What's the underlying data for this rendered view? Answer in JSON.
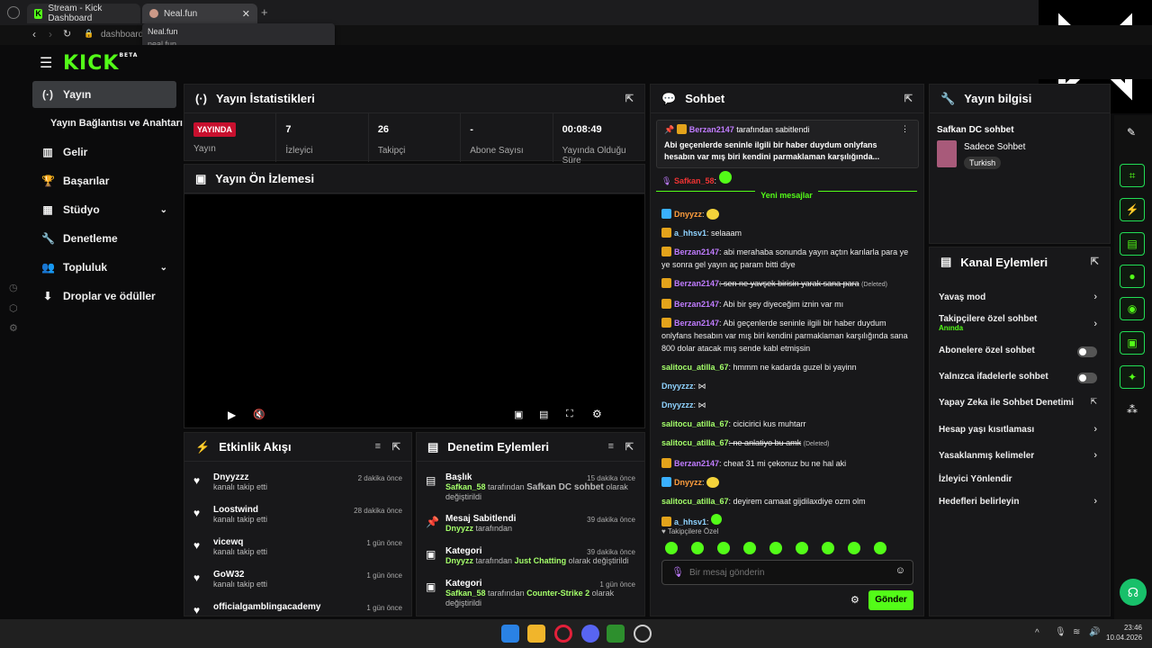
{
  "browser": {
    "tabs": [
      {
        "label": "Stream - Kick Dashboard"
      },
      {
        "label": "Neal.fun"
      }
    ],
    "address": "dashboard.",
    "tooltip": {
      "title": "Neal.fun",
      "url": "neal.fun"
    }
  },
  "app": {
    "logo": "KICK",
    "logo_sup": "BETA"
  },
  "sidebar": {
    "items": [
      {
        "label": "Yayın"
      },
      {
        "label": "Yayın Bağlantısı ve Anahtarı"
      },
      {
        "label": "Gelir"
      },
      {
        "label": "Başarılar"
      },
      {
        "label": "Stüdyo"
      },
      {
        "label": "Denetleme"
      },
      {
        "label": "Topluluk"
      },
      {
        "label": "Droplar ve ödüller"
      }
    ]
  },
  "stats_panel": {
    "title": "Yayın İstatistikleri",
    "live_badge": "YAYINDA",
    "stream_label": "Yayın",
    "viewers": {
      "value": "7",
      "label": "İzleyici"
    },
    "followers": {
      "value": "26",
      "label": "Takipçi"
    },
    "subs": {
      "value": "-",
      "label": "Abone Sayısı"
    },
    "uptime": {
      "value": "00:08:49",
      "label": "Yayında Olduğu Süre"
    }
  },
  "preview_panel": {
    "title": "Yayın Ön İzlemesi"
  },
  "activity_panel": {
    "title": "Etkinlik Akışı",
    "items": [
      {
        "name": "Dnyyzzz",
        "sub": "kanalı takip etti",
        "time": "2 dakika önce"
      },
      {
        "name": "Loostwind",
        "sub": "kanalı takip etti",
        "time": "28 dakika önce"
      },
      {
        "name": "vicewq",
        "sub": "kanalı takip etti",
        "time": "1 gün önce"
      },
      {
        "name": "GoW32",
        "sub": "kanalı takip etti",
        "time": "1 gün önce"
      },
      {
        "name": "officialgamblingacademy",
        "sub": "",
        "time": "1 gün önce"
      }
    ]
  },
  "mod_panel": {
    "title": "Denetim Eylemleri",
    "items": [
      {
        "title": "Başlık",
        "user": "Safkan_58",
        "mid": "tarafından",
        "target": "Safkan DC sohbet",
        "end": "olarak değiştirildi",
        "time": "15 dakika önce"
      },
      {
        "title": "Mesaj Sabitlendi",
        "user": "Dnyyzz",
        "mid": "tarafından",
        "target": "",
        "end": "",
        "time": "39 dakika önce"
      },
      {
        "title": "Kategori",
        "user": "Dnyyzz",
        "mid": "tarafından",
        "target": "Just Chatting",
        "end": "olarak değiştirildi",
        "time": "39 dakika önce"
      },
      {
        "title": "Kategori",
        "user": "Safkan_58",
        "mid": "tarafından",
        "target": "Counter-Strike 2",
        "end": "olarak değiştirildi",
        "time": "1 gün önce"
      }
    ]
  },
  "chat": {
    "title": "Sohbet",
    "pinned_by": "Berzan2147",
    "pinned_suffix": "tarafından sabitlendi",
    "pinned_text": "Abi geçenlerde seninle ilgili bir haber duydum onlyfans hesabın var mış biri kendini parmaklaman karşılığında...",
    "top_user": "Safkan_58",
    "new_messages": "Yeni mesajlar",
    "messages": [
      {
        "user": "Dnyyzz",
        "text": "",
        "cls": "orange"
      },
      {
        "user": "a_hhsv1",
        "text": ": selaaam",
        "cls": "lblue"
      },
      {
        "user": "Berzan2147",
        "text": ": abi merahaba sonunda yayın açtın karılarla para ye ye sonra gel yayın aç param bitti diye",
        "cls": "purple"
      },
      {
        "user": "Berzan2147",
        "text": ": sen ne yavşek birisin yarak sana para",
        "cls": "purple",
        "deleted": "(Deleted)"
      },
      {
        "user": "Berzan2147",
        "text": ": Abi bir şey diyeceğim iznin var mı",
        "cls": "purple"
      },
      {
        "user": "Berzan2147",
        "text": ": Abi geçenlerde seninle ilgili bir haber duydum onlyfans hesabın var mış biri kendini parmaklaman karşılığında sana 800 dolar atacak mış sende kabl etmişsin",
        "cls": "purple"
      },
      {
        "user": "salitocu_atilla_67",
        "text": ": hmmm ne kadarda guzel bi yayinn",
        "cls": "green"
      },
      {
        "user": "Dnyyzzz",
        "text": ":",
        "cls": "lblue"
      },
      {
        "user": "Dnyyzzz",
        "text": ":",
        "cls": "lblue"
      },
      {
        "user": "salitocu_atilla_67",
        "text": ": cicicirici kus muhtarr",
        "cls": "green"
      },
      {
        "user": "salitocu_atilla_67",
        "text": ": ne anlatiyo bu amk",
        "cls": "green",
        "deleted": "(Deleted)"
      },
      {
        "user": "Berzan2147",
        "text": ": cheat 31 mi çekonuz bu ne hal aki",
        "cls": "purple"
      },
      {
        "user": "Dnyyzz",
        "text": ":",
        "cls": "orange"
      },
      {
        "user": "salitocu_atilla_67",
        "text": ": deyirem camaat gijdilaxdiye ozm olm",
        "cls": "green"
      },
      {
        "user": "a_hhsv1",
        "text": ":",
        "cls": "lblue"
      }
    ],
    "followers_only": "Takipçilere Özel",
    "input_placeholder": "Bir mesaj gönderin",
    "send": "Gönder"
  },
  "stream_info": {
    "title": "Yayın bilgisi",
    "stream_title": "Safkan DC sohbet",
    "category": "Sadece Sohbet",
    "tag": "Turkish"
  },
  "channel_actions": {
    "title": "Kanal Eylemleri",
    "items": [
      {
        "label": "Yavaş mod",
        "sub": "",
        "ctrl": "arrow"
      },
      {
        "label": "Takipçilere özel sohbet",
        "sub": "Anında",
        "ctrl": "arrow"
      },
      {
        "label": "Abonelere özel sohbet",
        "sub": "",
        "ctrl": "toggle"
      },
      {
        "label": "Yalnızca ifadelerle sohbet",
        "sub": "",
        "ctrl": "toggle"
      },
      {
        "label": "Yapay Zeka ile Sohbet Denetimi",
        "sub": "",
        "ctrl": "ext"
      },
      {
        "label": "Hesap yaşı kısıtlaması",
        "sub": "",
        "ctrl": "arrow"
      },
      {
        "label": "Yasaklanmış kelimeler",
        "sub": "",
        "ctrl": "arrow"
      },
      {
        "label": "İzleyici Yönlendir",
        "sub": "",
        "ctrl": "none"
      },
      {
        "label": "Hedefleri belirleyin",
        "sub": "",
        "ctrl": "arrow"
      }
    ]
  },
  "clock": {
    "time": "23:46",
    "date": "10.04.2026"
  },
  "colors": {
    "accent": "#53fc18",
    "live": "#c8102e",
    "panel": "#18181a"
  }
}
